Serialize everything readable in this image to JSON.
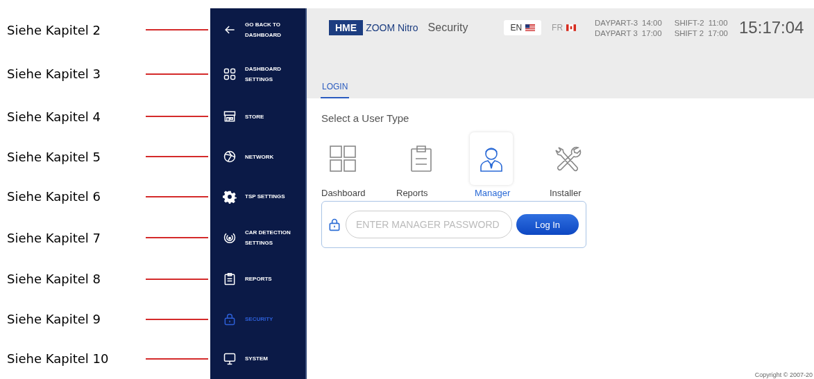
{
  "annotations": [
    {
      "label": "Siehe Kapitel 2"
    },
    {
      "label": "Siehe Kapitel 3"
    },
    {
      "label": "Siehe Kapitel 4"
    },
    {
      "label": "Siehe Kapitel 5"
    },
    {
      "label": "Siehe Kapitel 6"
    },
    {
      "label": "Siehe Kapitel 7"
    },
    {
      "label": "Siehe Kapitel 8"
    },
    {
      "label": "Siehe Kapitel 9"
    },
    {
      "label": "Siehe Kapitel 10"
    }
  ],
  "sidebar": {
    "items": [
      {
        "label": "GO BACK TO DASHBOARD",
        "selected": false
      },
      {
        "label": "DASHBOARD SETTINGS",
        "selected": false
      },
      {
        "label": "STORE",
        "selected": false
      },
      {
        "label": "NETWORK",
        "selected": false
      },
      {
        "label": "TSP SETTINGS",
        "selected": false
      },
      {
        "label": "CAR DETECTION SETTINGS",
        "selected": false
      },
      {
        "label": "REPORTS",
        "selected": false
      },
      {
        "label": "SECURITY",
        "selected": true
      },
      {
        "label": "SYSTEM",
        "selected": false
      }
    ]
  },
  "header": {
    "logo": "HME",
    "product": "ZOOM Nitro",
    "page_title": "Security",
    "languages": [
      {
        "label": "EN",
        "selected": true
      },
      {
        "label": "FR",
        "selected": false
      }
    ],
    "schedule": [
      [
        "DAYPART-3",
        "14:00",
        "SHIFT-2",
        "11:00"
      ],
      [
        "DAYPART 3",
        "17:00",
        "SHIFT 2",
        "17:00"
      ]
    ],
    "clock": "15:17:04"
  },
  "tabs": [
    {
      "label": "LOGIN",
      "selected": true
    }
  ],
  "heading": "Select a User Type",
  "user_types": [
    {
      "label": "Dashboard",
      "selected": false
    },
    {
      "label": "Reports",
      "selected": false
    },
    {
      "label": "Manager",
      "selected": true
    },
    {
      "label": "Installer",
      "selected": false
    }
  ],
  "login": {
    "placeholder": "ENTER MANAGER PASSWORD",
    "button": "Log In"
  },
  "footer": {
    "copyright": "Copyright © 2007-20"
  }
}
